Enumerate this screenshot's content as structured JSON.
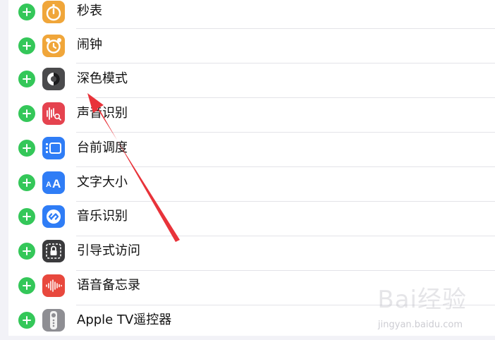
{
  "controls": [
    {
      "label": "秒表",
      "icon": "stopwatch-icon",
      "color": "#f0a63a"
    },
    {
      "label": "闹钟",
      "icon": "alarm-clock-icon",
      "color": "#f0a63a"
    },
    {
      "label": "深色模式",
      "icon": "dark-mode-icon",
      "color": "#4a4a4c"
    },
    {
      "label": "声音识别",
      "icon": "sound-recognition-icon",
      "color": "#e5434f"
    },
    {
      "label": "台前调度",
      "icon": "stage-manager-icon",
      "color": "#2f7df6"
    },
    {
      "label": "文字大小",
      "icon": "text-size-icon",
      "color": "#2f7df6"
    },
    {
      "label": "音乐识别",
      "icon": "shazam-icon",
      "color": "#2f7df6"
    },
    {
      "label": "引导式访问",
      "icon": "guided-access-icon",
      "color": "#3a3a3c"
    },
    {
      "label": "语音备忘录",
      "icon": "voice-memos-icon",
      "color": "#e8483d"
    },
    {
      "label": "Apple TV遥控器",
      "icon": "apple-tv-remote-icon",
      "color": "#8e8e93"
    }
  ],
  "watermark": {
    "logo": "Bai经验",
    "url": "jingyan.baidu.com"
  },
  "colors": {
    "add": "#34c759",
    "annotation_arrow": "#e8333a"
  }
}
